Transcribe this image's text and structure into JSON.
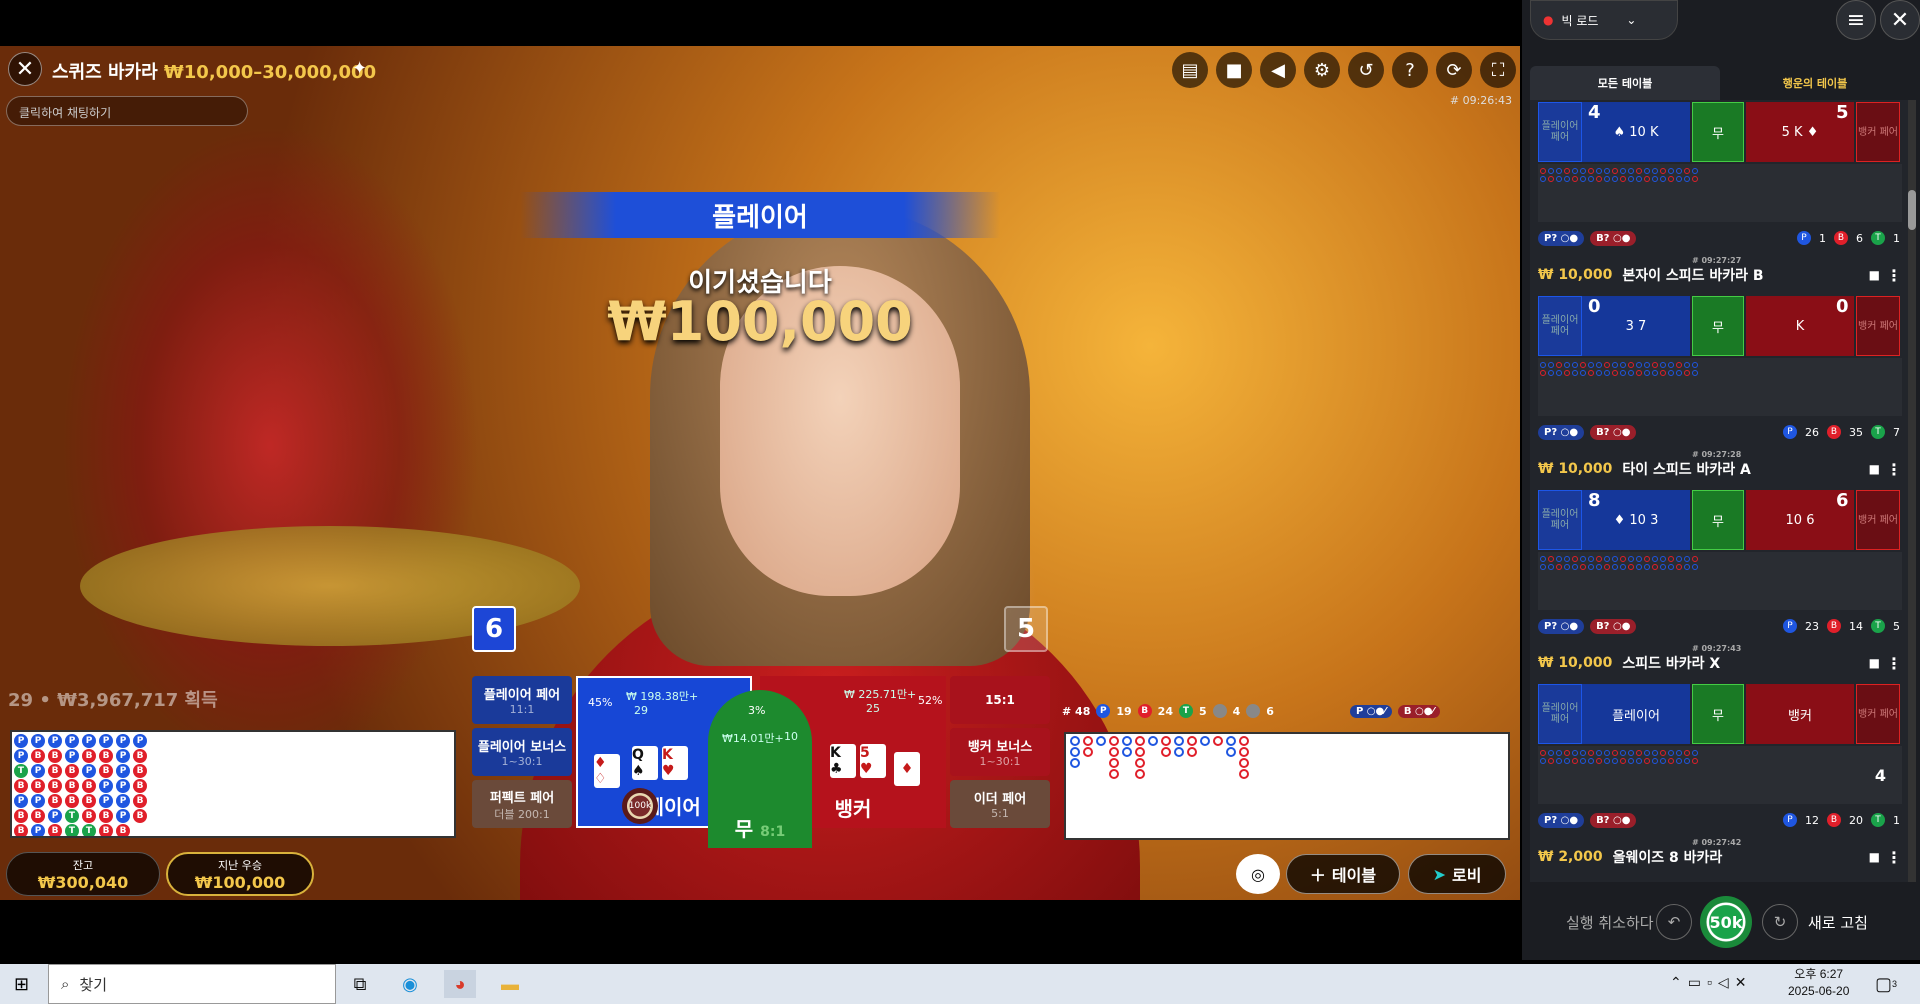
{
  "header": {
    "title": "스퀴즈 바카라",
    "limit": "₩10,000–30,000,000",
    "chat_placeholder": "클릭하여 채팅하기",
    "round_id": "# 09:26:43"
  },
  "controls": [
    "chat-icon",
    "video-icon",
    "volume-icon",
    "settings-icon",
    "history-icon",
    "help-icon",
    "rotate-icon",
    "fullscreen-icon"
  ],
  "result": {
    "banner": "플레이어",
    "message": "이기셨습니다",
    "amount": "₩100,000",
    "player_score": "6",
    "banker_score": "5"
  },
  "ticker": "29 • ₩3,967,717 획득",
  "side_bets": {
    "player_pair": {
      "label": "플레이어 페어",
      "odds": "11:1"
    },
    "player_bonus": {
      "label": "플레이어 보너스",
      "odds": "1~30:1"
    },
    "perfect_pair": {
      "label": "퍼펙트 페어",
      "odds": "더블 200:1"
    },
    "banker_pair_odds": "15:1",
    "banker_bonus": {
      "label": "뱅커 보너스",
      "odds": "1~30:1"
    },
    "either_pair": {
      "label": "이더 페어",
      "odds": "5:1"
    }
  },
  "main_bets": {
    "player": {
      "label": "플레이어",
      "pct": "45%",
      "amount": "₩ 198.38만+",
      "players": "29",
      "cards": [
        "♦ ♢",
        "Q ♠",
        "K ♥"
      ]
    },
    "tie": {
      "label": "무",
      "odds": "8:1",
      "pct": "3%",
      "amount": "₩14.01만+",
      "players": "10"
    },
    "banker": {
      "label": "뱅커",
      "pct": "52%",
      "amount": "₩ 225.71만+",
      "players": "25",
      "cards": [
        "K ♣",
        "5 ♥",
        "♦"
      ]
    },
    "chip": "100k"
  },
  "balance": {
    "label": "잔고",
    "value": "₩300,040"
  },
  "last_win": {
    "label": "지난 우승",
    "value": "₩100,000"
  },
  "road_stats": {
    "rounds": "# 48",
    "p": "19",
    "b": "24",
    "t": "5",
    "pp": "4",
    "bp": "6"
  },
  "bead_road": [
    [
      "P",
      "P",
      "P",
      "P",
      "P",
      "P",
      "P",
      "P"
    ],
    [
      "P",
      "B",
      "B",
      "P",
      "B",
      "B",
      "P",
      "B"
    ],
    [
      "T",
      "P",
      "B",
      "B",
      "P",
      "B",
      "P",
      "B"
    ],
    [
      "B",
      "B",
      "B",
      "B",
      "B",
      "P",
      "P",
      "B"
    ],
    [
      "P",
      "P",
      "B",
      "B",
      "B",
      "P",
      "P",
      "B"
    ],
    [
      "B",
      "B",
      "P",
      "T",
      "B",
      "B",
      "P",
      "B"
    ],
    [
      "B",
      "P",
      "B",
      "T",
      "T",
      "B",
      "B"
    ]
  ],
  "buttons": {
    "table": "테이블",
    "lobby": "로비"
  },
  "panel": {
    "road_select": "빅 로드",
    "tabs": [
      "모든 테이블",
      "행운의 테이블"
    ],
    "tables": [
      {
        "bet": "",
        "name": "",
        "time": "",
        "p_num": "4",
        "b_num": "5",
        "p_cards": "♠ 10 K",
        "b_cards": "5 K ♦",
        "counts": {
          "p": "1",
          "b": "6",
          "t": "1"
        }
      },
      {
        "bet": "₩ 10,000",
        "name": "본자이 스피드 바카라 B",
        "time": "# 09:27:27",
        "p_num": "0",
        "b_num": "0",
        "p_cards": "3 7",
        "b_cards": "K",
        "counts": {
          "p": "26",
          "b": "35",
          "t": "7"
        }
      },
      {
        "bet": "₩ 10,000",
        "name": "타이 스피드 바카라 A",
        "time": "# 09:27:28",
        "p_num": "8",
        "b_num": "6",
        "p_cards": "♦ 10 3",
        "b_cards": "10 6",
        "counts": {
          "p": "23",
          "b": "14",
          "t": "5"
        }
      },
      {
        "bet": "₩ 10,000",
        "name": "스피드 바카라 X",
        "time": "# 09:27:43",
        "p_num": "",
        "b_num": "",
        "p_cards": "플레이어",
        "b_cards": "뱅커",
        "counts": {
          "p": "12",
          "b": "20",
          "t": "1"
        },
        "countdown": "4"
      },
      {
        "bet": "₩ 2,000",
        "name": "올웨이즈 8 바카라",
        "time": "# 09:27:42",
        "p_num": "",
        "b_num": "",
        "p_cards": "",
        "b_cards": "",
        "counts": null
      }
    ],
    "pair_label": "플레이어 페어",
    "pair_label_b": "뱅커 페어",
    "tie_label": "무",
    "undo": "실행 취소하다",
    "chip": "50k",
    "refresh": "새로 고침"
  },
  "taskbar": {
    "search": "찾기",
    "time": "오후 6:27",
    "date": "2025-06-20",
    "notifications": "3"
  }
}
